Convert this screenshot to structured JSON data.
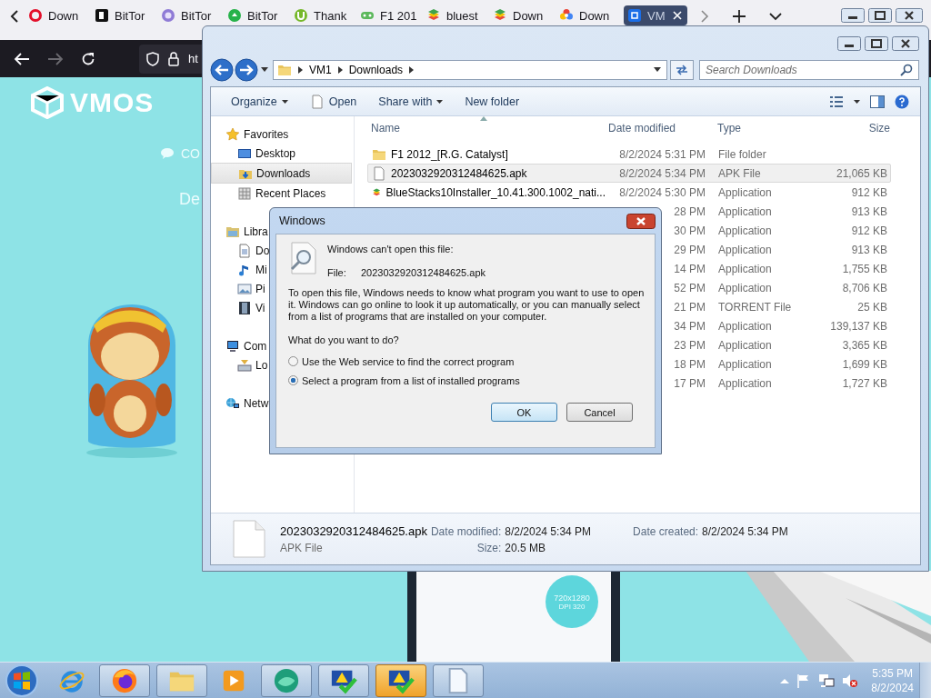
{
  "browser": {
    "tabs": [
      {
        "kind": "ring",
        "label": "Down",
        "selected": false
      },
      {
        "kind": "square",
        "label": "BitTor",
        "selected": false
      },
      {
        "kind": "purple",
        "label": "BitTor",
        "selected": false
      },
      {
        "kind": "green",
        "label": "BitTor",
        "selected": false
      },
      {
        "kind": "utorrent",
        "label": "Thank",
        "selected": false
      },
      {
        "kind": "gamepad",
        "label": "F1 201",
        "selected": false
      },
      {
        "kind": "stack",
        "label": "bluest",
        "selected": false
      },
      {
        "kind": "stack",
        "label": "Down",
        "selected": false
      },
      {
        "kind": "flower",
        "label": "Down",
        "selected": false
      },
      {
        "kind": "cube",
        "label": "VM",
        "selected": true
      }
    ],
    "url": "ht"
  },
  "webpage": {
    "logo": "VMOS",
    "menu_item": "CO",
    "heading": "De",
    "phone_badge": {
      "resolution": "720x1280",
      "dpi": "DPI 320"
    }
  },
  "explorer": {
    "breadcrumb": [
      "VM1",
      "Downloads"
    ],
    "search": {
      "placeholder": "Search Downloads"
    },
    "toolbar": [
      {
        "kind": "menu",
        "label": "Organize"
      },
      {
        "kind": "open",
        "label": "Open"
      },
      {
        "kind": "menu",
        "label": "Share with"
      },
      {
        "kind": "plain",
        "label": "New folder"
      }
    ],
    "nav": [
      {
        "kind": "star",
        "label": "Favorites",
        "selected": false,
        "children": [
          {
            "kind": "desktop",
            "label": "Desktop",
            "selected": false
          },
          {
            "kind": "downloads",
            "label": "Downloads",
            "selected": true
          },
          {
            "kind": "recent",
            "label": "Recent Places",
            "selected": false
          }
        ]
      },
      {
        "kind": "library",
        "label": "Libra",
        "selected": false,
        "children": [
          {
            "kind": "documents",
            "label": "Do",
            "selected": false
          },
          {
            "kind": "music",
            "label": "Mi",
            "selected": false
          },
          {
            "kind": "pictures",
            "label": "Pi",
            "selected": false
          },
          {
            "kind": "videos",
            "label": "Vi",
            "selected": false
          }
        ]
      },
      {
        "kind": "computer",
        "label": "Com",
        "selected": false,
        "children": [
          {
            "kind": "disk",
            "label": "Lo",
            "selected": false
          }
        ]
      },
      {
        "kind": "network",
        "label": "Netw",
        "selected": false
      }
    ],
    "columns": [
      "Name",
      "Date modified",
      "Type",
      "Size"
    ],
    "rows": [
      {
        "kind": "folder",
        "name": "F1 2012_[R.G. Catalyst]",
        "date": "8/2/2024 5:31 PM",
        "type": "File folder",
        "selected": false
      },
      {
        "kind": "file",
        "name": "2023032920312484625.apk",
        "date": "8/2/2024 5:34 PM",
        "type": "APK File",
        "size": "21,065 KB",
        "selected": true
      },
      {
        "kind": "installer",
        "name": "BlueStacks10Installer_10.41.300.1002_nati...",
        "date": "8/2/2024 5:30 PM",
        "type": "Application",
        "size": "912 KB",
        "selected": false
      },
      {
        "kind": "hidden",
        "date": "28 PM",
        "type": "Application",
        "size": "913 KB",
        "selected": false
      },
      {
        "kind": "hidden",
        "date": "30 PM",
        "type": "Application",
        "size": "912 KB",
        "selected": false
      },
      {
        "kind": "hidden",
        "date": "29 PM",
        "type": "Application",
        "size": "913 KB",
        "selected": false
      },
      {
        "kind": "hidden",
        "date": "14 PM",
        "type": "Application",
        "size": "1,755 KB",
        "selected": false
      },
      {
        "kind": "hidden",
        "date": "52 PM",
        "type": "Application",
        "size": "8,706 KB",
        "selected": false
      },
      {
        "kind": "hidden",
        "date": "21 PM",
        "type": "TORRENT File",
        "size": "25 KB",
        "selected": false
      },
      {
        "kind": "hidden",
        "date": "34 PM",
        "type": "Application",
        "size": "139,137 KB",
        "selected": false
      },
      {
        "kind": "hidden",
        "date": "23 PM",
        "type": "Application",
        "size": "3,365 KB",
        "selected": false
      },
      {
        "kind": "hidden",
        "date": "18 PM",
        "type": "Application",
        "size": "1,699 KB",
        "selected": false
      },
      {
        "kind": "hidden",
        "date": "17 PM",
        "type": "Application",
        "size": "1,727 KB",
        "selected": false
      }
    ],
    "details": {
      "name": "2023032920312484625.apk",
      "type": "APK File",
      "modified_label": "Date modified:",
      "modified": "8/2/2024 5:34 PM",
      "size_label": "Size:",
      "size": "20.5 MB",
      "created_label": "Date created:",
      "created": "8/2/2024 5:34 PM"
    }
  },
  "dialog": {
    "title": "Windows",
    "heading": "Windows can't open this file:",
    "file_label": "File:",
    "file_name": "2023032920312484625.apk",
    "message": "To open this file, Windows needs to know what program you want to use to open it. Windows can go online to look it up automatically, or you can manually select from a list of programs that are installed on your computer.",
    "question": "What do you want to do?",
    "options": [
      {
        "label": "Use the Web service to find the correct program",
        "selected": false
      },
      {
        "label": "Select a program from a list of installed programs",
        "selected": true
      }
    ],
    "buttons": [
      {
        "kind": "default",
        "label": "OK"
      },
      {
        "kind": "normal",
        "label": "Cancel"
      }
    ]
  },
  "taskbar": {
    "apps": [
      {
        "kind": "ie",
        "running": false,
        "active": false
      },
      {
        "kind": "firefox",
        "running": true,
        "active": false
      },
      {
        "kind": "folder",
        "running": true,
        "active": false
      },
      {
        "kind": "media",
        "running": false,
        "active": false
      },
      {
        "kind": "globe",
        "running": true,
        "active": false
      },
      {
        "kind": "shield",
        "running": true,
        "active": false
      },
      {
        "kind": "shield",
        "running": true,
        "active": true
      },
      {
        "kind": "document",
        "running": true,
        "active": false
      }
    ],
    "time": "5:35 PM",
    "date": "8/2/2024"
  }
}
